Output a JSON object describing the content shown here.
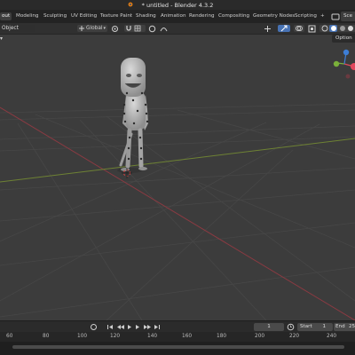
{
  "window": {
    "title": "* untitled - Blender 4.3.2"
  },
  "workspace_tabs": [
    {
      "label": "out",
      "active": true
    },
    {
      "label": "Modeling"
    },
    {
      "label": "Sculpting"
    },
    {
      "label": "UV Editing"
    },
    {
      "label": "Texture Paint"
    },
    {
      "label": "Shading"
    },
    {
      "label": "Animation"
    },
    {
      "label": "Rendering"
    },
    {
      "label": "Compositing"
    },
    {
      "label": "Geometry Nodes"
    },
    {
      "label": "Scripting"
    }
  ],
  "scene_label": "Sce",
  "header": {
    "mode": "Object",
    "orientation": "Global"
  },
  "viewport": {
    "options_label": "Option"
  },
  "timeline": {
    "current_frame": "1",
    "start_label": "Start",
    "start_value": "1",
    "end_label": "End",
    "end_value": "25"
  },
  "ruler": {
    "ticks": [
      "60",
      "80",
      "100",
      "120",
      "140",
      "160",
      "180",
      "200",
      "220",
      "240"
    ]
  },
  "colors": {
    "x_axis": "#8b3a42",
    "y_axis": "#6e8234",
    "gizmo_x": "#e2475d",
    "gizmo_y": "#7ab03a",
    "gizmo_z": "#3d7ed6"
  }
}
